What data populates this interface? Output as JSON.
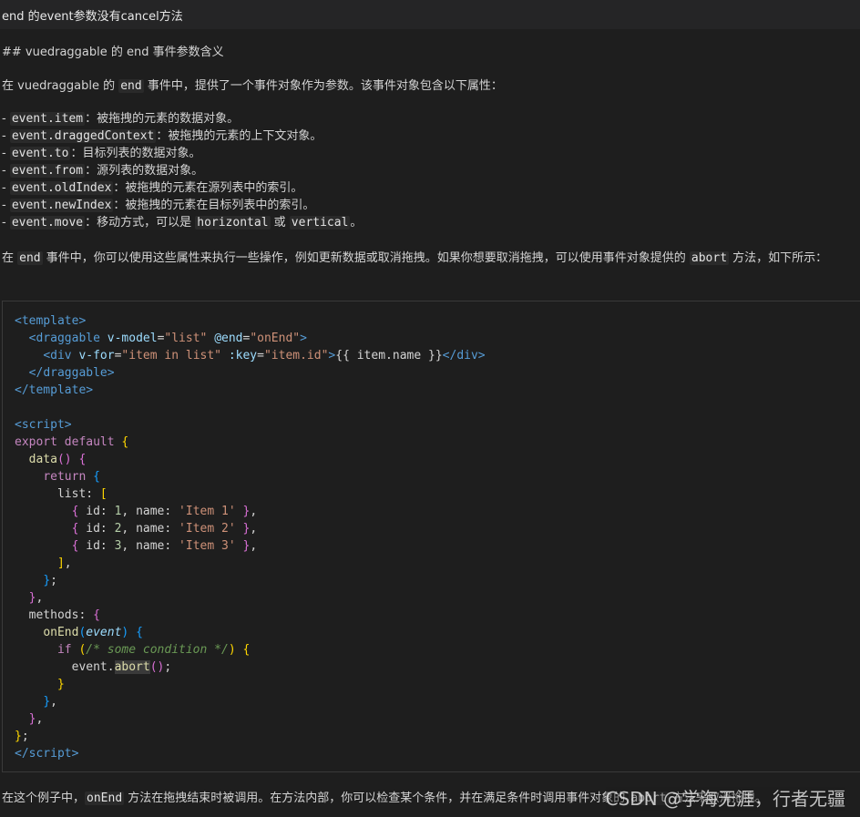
{
  "header": {
    "title": "end 的event参数没有cancel方法"
  },
  "paragraphs": {
    "heading": "## vuedraggable 的 end 事件参数含义",
    "intro": [
      {
        "t": "在 vuedraggable 的 "
      },
      {
        "t": "end",
        "c": 1
      },
      {
        "t": " 事件中，提供了一个事件对象作为参数。该事件对象包含以下属性："
      }
    ],
    "properties": [
      [
        {
          "t": "- "
        },
        {
          "t": "event.item",
          "c": 1
        },
        {
          "t": "：被拖拽的元素的数据对象。"
        }
      ],
      [
        {
          "t": "- "
        },
        {
          "t": "event.draggedContext",
          "c": 1
        },
        {
          "t": "：被拖拽的元素的上下文对象。"
        }
      ],
      [
        {
          "t": "- "
        },
        {
          "t": "event.to",
          "c": 1
        },
        {
          "t": "：目标列表的数据对象。"
        }
      ],
      [
        {
          "t": "- "
        },
        {
          "t": "event.from",
          "c": 1
        },
        {
          "t": "：源列表的数据对象。"
        }
      ],
      [
        {
          "t": "- "
        },
        {
          "t": "event.oldIndex",
          "c": 1
        },
        {
          "t": "：被拖拽的元素在源列表中的索引。"
        }
      ],
      [
        {
          "t": "- "
        },
        {
          "t": "event.newIndex",
          "c": 1
        },
        {
          "t": "：被拖拽的元素在目标列表中的索引。"
        }
      ],
      [
        {
          "t": "- "
        },
        {
          "t": "event.move",
          "c": 1
        },
        {
          "t": "：移动方式，可以是 "
        },
        {
          "t": "horizontal",
          "c": 1
        },
        {
          "t": " 或 "
        },
        {
          "t": "vertical",
          "c": 1
        },
        {
          "t": "。"
        }
      ]
    ],
    "usage": [
      {
        "t": "在 "
      },
      {
        "t": "end",
        "c": 1
      },
      {
        "t": " 事件中，你可以使用这些属性来执行一些操作，例如更新数据或取消拖拽。如果你想要取消拖拽，可以使用事件对象提供的 "
      },
      {
        "t": "abort",
        "c": 1
      },
      {
        "t": " 方法，如下所示："
      }
    ],
    "bottom": [
      {
        "t": "在这个例子中，"
      },
      {
        "t": "onEnd",
        "c": 1
      },
      {
        "t": " 方法在拖拽结束时被调用。在方法内部，你可以检查某个条件，并在满足条件时调用事件对象的 "
      },
      {
        "t": "abort",
        "c": 1
      },
      {
        "t": " 方法来取消拖拽。"
      }
    ]
  },
  "code": {
    "colors": {
      "tag": "#569cd6",
      "attr": "#9cdcfe",
      "string": "#ce9178",
      "keyword": "#c586c0",
      "declaration": "#569cd6",
      "function": "#dcdcaa",
      "number": "#b5cea8",
      "comment": "#6a9955",
      "bracket1": "#ffd700",
      "bracket2": "#da70d6",
      "bracket3": "#179fff",
      "plain": "#d4d4d4"
    },
    "lines": [
      [
        [
          "<",
          "tag"
        ],
        [
          "template",
          "tag"
        ],
        [
          ">",
          "tag"
        ]
      ],
      [
        [
          "  ",
          ""
        ],
        [
          "<",
          "tag"
        ],
        [
          "draggable",
          "tag"
        ],
        [
          " ",
          ""
        ],
        [
          "v-model",
          "attr"
        ],
        [
          "=",
          ""
        ],
        [
          "\"list\"",
          "string"
        ],
        [
          " ",
          ""
        ],
        [
          "@end",
          "attr"
        ],
        [
          "=",
          ""
        ],
        [
          "\"onEnd\"",
          "string"
        ],
        [
          ">",
          "tag"
        ]
      ],
      [
        [
          "    ",
          ""
        ],
        [
          "<",
          "tag"
        ],
        [
          "div",
          "tag"
        ],
        [
          " ",
          ""
        ],
        [
          "v-for",
          "attr"
        ],
        [
          "=",
          ""
        ],
        [
          "\"item in list\"",
          "string"
        ],
        [
          " ",
          ""
        ],
        [
          ":key",
          "attr"
        ],
        [
          "=",
          ""
        ],
        [
          "\"item.id\"",
          "string"
        ],
        [
          ">",
          "tag"
        ],
        [
          "{{ item.name }}",
          ""
        ],
        [
          "</",
          "tag"
        ],
        [
          "div",
          "tag"
        ],
        [
          ">",
          "tag"
        ]
      ],
      [
        [
          "  ",
          ""
        ],
        [
          "</",
          "tag"
        ],
        [
          "draggable",
          "tag"
        ],
        [
          ">",
          "tag"
        ]
      ],
      [
        [
          "</",
          "tag"
        ],
        [
          "template",
          "tag"
        ],
        [
          ">",
          "tag"
        ]
      ],
      [],
      [
        [
          "<",
          "tag"
        ],
        [
          "script",
          "tag"
        ],
        [
          ">",
          "tag"
        ]
      ],
      [
        [
          "export",
          "keyword"
        ],
        [
          " ",
          ""
        ],
        [
          "default",
          "keyword"
        ],
        [
          " ",
          ""
        ],
        [
          "{",
          "bracket1"
        ]
      ],
      [
        [
          "  ",
          ""
        ],
        [
          "data",
          "function"
        ],
        [
          "()",
          "bracket2"
        ],
        [
          " ",
          ""
        ],
        [
          "{",
          "bracket2"
        ]
      ],
      [
        [
          "    ",
          ""
        ],
        [
          "return",
          "keyword"
        ],
        [
          " ",
          ""
        ],
        [
          "{",
          "bracket3"
        ]
      ],
      [
        [
          "      list: ",
          ""
        ],
        [
          "[",
          "bracket1"
        ]
      ],
      [
        [
          "        ",
          ""
        ],
        [
          "{",
          "bracket2"
        ],
        [
          " id: ",
          ""
        ],
        [
          "1",
          "number"
        ],
        [
          ", name: ",
          ""
        ],
        [
          "'Item 1'",
          "string"
        ],
        [
          " ",
          ""
        ],
        [
          "}",
          "bracket2"
        ],
        [
          ",",
          ""
        ]
      ],
      [
        [
          "        ",
          ""
        ],
        [
          "{",
          "bracket2"
        ],
        [
          " id: ",
          ""
        ],
        [
          "2",
          "number"
        ],
        [
          ", name: ",
          ""
        ],
        [
          "'Item 2'",
          "string"
        ],
        [
          " ",
          ""
        ],
        [
          "}",
          "bracket2"
        ],
        [
          ",",
          ""
        ]
      ],
      [
        [
          "        ",
          ""
        ],
        [
          "{",
          "bracket2"
        ],
        [
          " id: ",
          ""
        ],
        [
          "3",
          "number"
        ],
        [
          ", name: ",
          ""
        ],
        [
          "'Item 3'",
          "string"
        ],
        [
          " ",
          ""
        ],
        [
          "}",
          "bracket2"
        ],
        [
          ",",
          ""
        ]
      ],
      [
        [
          "      ",
          ""
        ],
        [
          "]",
          "bracket1"
        ],
        [
          ",",
          ""
        ]
      ],
      [
        [
          "    ",
          ""
        ],
        [
          "}",
          "bracket3"
        ],
        [
          ";",
          ""
        ]
      ],
      [
        [
          "  ",
          ""
        ],
        [
          "}",
          "bracket2"
        ],
        [
          ",",
          ""
        ]
      ],
      [
        [
          "  methods: ",
          ""
        ],
        [
          "{",
          "bracket2"
        ]
      ],
      [
        [
          "    ",
          ""
        ],
        [
          "onEnd",
          "function"
        ],
        [
          "(",
          "bracket3"
        ],
        [
          "event",
          "attr"
        ],
        [
          ")",
          "bracket3"
        ],
        [
          " ",
          ""
        ],
        [
          "{",
          "bracket3"
        ]
      ],
      [
        [
          "      ",
          ""
        ],
        [
          "if",
          "keyword"
        ],
        [
          " ",
          ""
        ],
        [
          "(",
          "bracket1"
        ],
        [
          "/* some condition */",
          "comment"
        ],
        [
          ")",
          "bracket1"
        ],
        [
          " ",
          ""
        ],
        [
          "{",
          "bracket1"
        ]
      ],
      [
        [
          "        event.",
          ""
        ],
        [
          "abort",
          "function"
        ],
        [
          "()",
          "bracket2"
        ],
        [
          ";",
          ""
        ]
      ],
      [
        [
          "      ",
          ""
        ],
        [
          "}",
          "bracket1"
        ]
      ],
      [
        [
          "    ",
          ""
        ],
        [
          "}",
          "bracket3"
        ],
        [
          ",",
          ""
        ]
      ],
      [
        [
          "  ",
          ""
        ],
        [
          "}",
          "bracket2"
        ],
        [
          ",",
          ""
        ]
      ],
      [
        [
          "}",
          "bracket1"
        ],
        [
          ";",
          ""
        ]
      ],
      [
        [
          "</",
          "tag"
        ],
        [
          "script",
          "tag"
        ],
        [
          ">",
          "tag"
        ]
      ]
    ]
  },
  "watermark": {
    "text": "CSDN @学海无涯，行者无疆"
  }
}
